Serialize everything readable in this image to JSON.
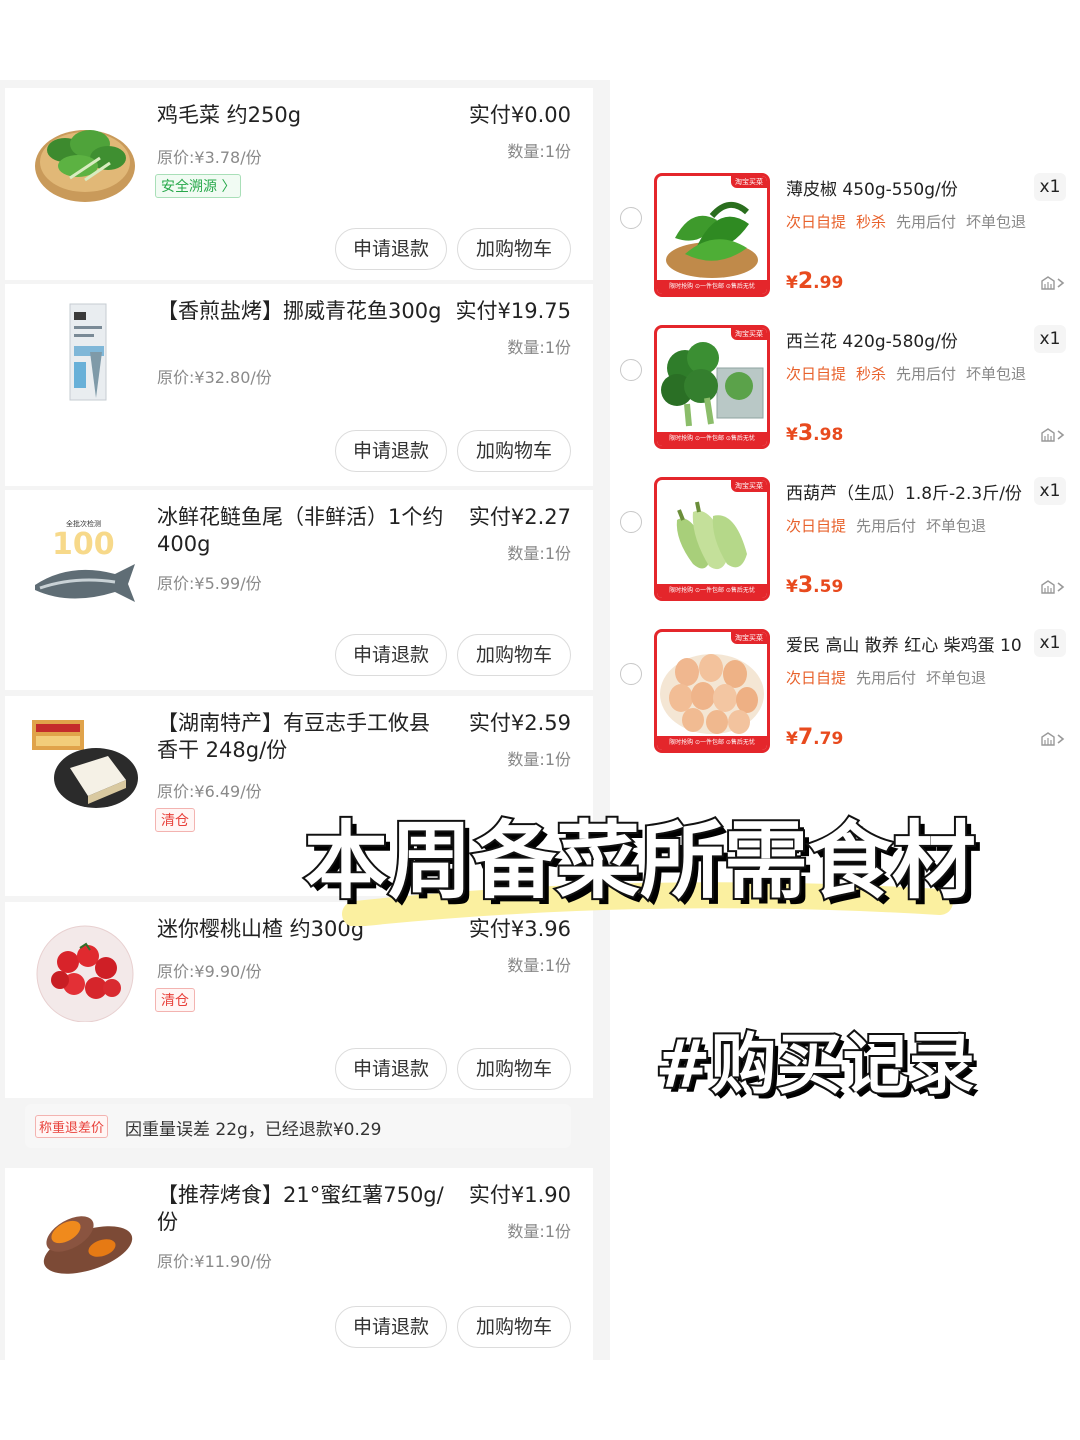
{
  "orders": [
    {
      "name": "鸡毛菜 约250g",
      "paid": "实付¥0.00",
      "qty": "数量:1份",
      "original_price": "原价:¥3.78/份",
      "tag": "安全溯源 〉",
      "tag_color": "green",
      "refund_label": "申请退款",
      "cart_label": "加购物车",
      "thumb": "leafy-greens"
    },
    {
      "name": "【香煎盐烤】挪威青花鱼300g",
      "paid": "实付¥19.75",
      "qty": "数量:1份",
      "original_price": "原价:¥32.80/份",
      "tag": "",
      "refund_label": "申请退款",
      "cart_label": "加购物车",
      "thumb": "mackerel-pack"
    },
    {
      "name": "冰鲜花鲢鱼尾（非鲜活）1个约400g",
      "paid": "实付¥2.27",
      "qty": "数量:1份",
      "original_price": "原价:¥5.99/份",
      "tag": "",
      "refund_label": "申请退款",
      "cart_label": "加购物车",
      "thumb": "fish-tail"
    },
    {
      "name": "【湖南特产】有豆志手工攸县香干 248g/份",
      "paid": "实付¥2.59",
      "qty": "数量:1份",
      "original_price": "原价:¥6.49/份",
      "tag": "清仓",
      "tag_color": "red",
      "refund_label": "申请退款",
      "cart_label": "加购物车",
      "thumb": "dried-tofu"
    },
    {
      "name": "迷你樱桃山楂 约300g",
      "paid": "实付¥3.96",
      "qty": "数量:1份",
      "original_price": "原价:¥9.90/份",
      "tag": "清仓",
      "tag_color": "red",
      "refund_label": "申请退款",
      "cart_label": "加购物车",
      "thumb": "hawthorn"
    },
    {
      "name": "【推荐烤食】21°蜜红薯750g/份",
      "paid": "实付¥1.90",
      "qty": "数量:1份",
      "original_price": "原价:¥11.90/份",
      "tag": "",
      "refund_label": "申请退款",
      "cart_label": "加购物车",
      "thumb": "sweet-potato"
    }
  ],
  "refund_note": {
    "tag": "称重退差价",
    "text": "因重量误差 22g，已经退款¥0.29"
  },
  "cart_items": [
    {
      "name": "薄皮椒 450g-550g/份",
      "mult": "x1",
      "tags": [
        "次日自提",
        "秒杀",
        "先用后付",
        "坏单包退"
      ],
      "price_yen": "¥",
      "price_int": "2",
      "price_dec": ".99",
      "thumb": "green-peppers"
    },
    {
      "name": "西兰花 420g-580g/份",
      "mult": "x1",
      "tags": [
        "次日自提",
        "秒杀",
        "先用后付",
        "坏单包退"
      ],
      "price_yen": "¥",
      "price_int": "3",
      "price_dec": ".98",
      "thumb": "broccoli"
    },
    {
      "name": "西葫芦（生瓜）1.8斤-2.3斤/份",
      "mult": "x1",
      "tags": [
        "次日自提",
        "先用后付",
        "坏单包退"
      ],
      "price_yen": "¥",
      "price_int": "3",
      "price_dec": ".59",
      "thumb": "zucchini"
    },
    {
      "name": "爱民 高山 散养 红心 柴鸡蛋 10",
      "mult": "x1",
      "tags": [
        "次日自提",
        "先用后付",
        "坏单包退"
      ],
      "price_yen": "¥",
      "price_int": "7",
      "price_dec": ".79",
      "thumb": "eggs"
    }
  ],
  "cart_badge": "淘宝买菜",
  "cart_footer": "限时抢购 ⊙一件包邮 ⊙售后无忧",
  "headline": "本周备菜所需食材",
  "hashtag": "#购买记录",
  "colors": {
    "price_red": "#e84a1e",
    "tag_orange": "#e8612b",
    "frame_red": "#e4262b",
    "green_tag": "#27a84a",
    "highlight_yellow": "#fbf0a0"
  }
}
